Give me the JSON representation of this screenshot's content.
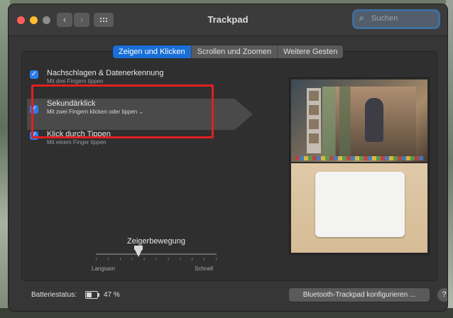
{
  "window": {
    "title": "Trackpad",
    "search_placeholder": "Suchen"
  },
  "tabs": [
    {
      "label": "Zeigen und Klicken",
      "active": true
    },
    {
      "label": "Scrollen und Zoomen",
      "active": false
    },
    {
      "label": "Weitere Gesten",
      "active": false
    }
  ],
  "options": [
    {
      "title": "Nachschlagen & Datenerkennung",
      "subtitle": "Mit drei Fingern tippen",
      "checked": true
    },
    {
      "title": "Sekundärklick",
      "subtitle": "Mit zwei Fingern klicken oder tippen",
      "checked": true
    },
    {
      "title": "Klick durch Tippen",
      "subtitle": "Mit einem Finger tippen",
      "checked": true
    }
  ],
  "pointer_speed": {
    "label": "Zeigerbewegung",
    "min_label": "Langsam",
    "max_label": "Schnell",
    "value_fraction": 0.35
  },
  "battery": {
    "label": "Batteriestatus:",
    "value": "47 %",
    "level_fraction": 0.47
  },
  "buttons": {
    "configure": "Bluetooth-Trackpad konfigurieren ...",
    "help": "?"
  },
  "icons": {
    "search": "search-icon",
    "back": "chevron-left-icon",
    "forward": "chevron-right-icon",
    "grid": "grid-icon",
    "checkbox": "checkmark-icon",
    "dropdown": "chevron-down-icon",
    "battery": "battery-icon"
  },
  "colors": {
    "accent": "#1a6fd8",
    "annotation": "#e02020"
  }
}
